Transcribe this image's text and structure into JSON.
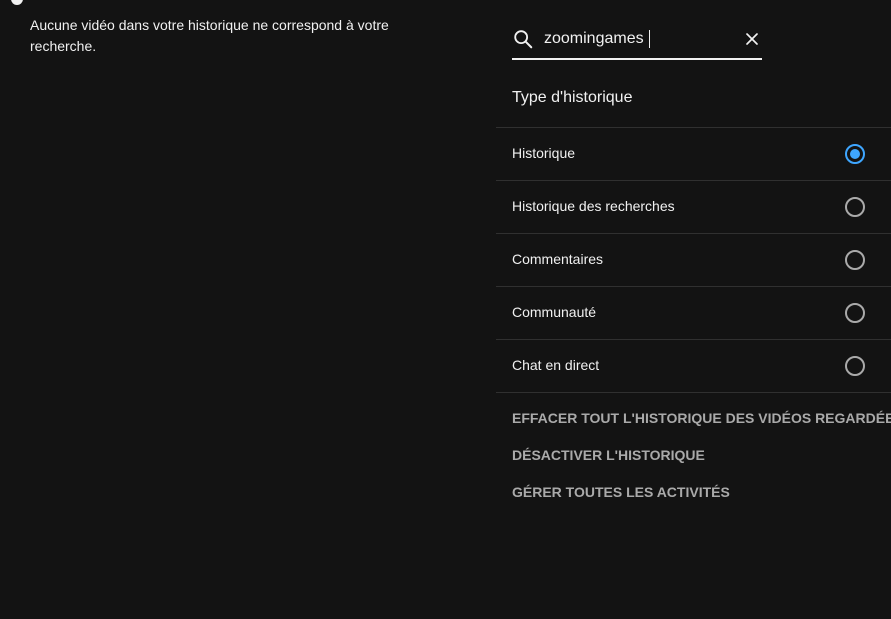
{
  "empty_message": "Aucune vidéo dans votre historique ne correspond à votre recherche.",
  "search": {
    "value": "zoomingames",
    "icon": "search-icon",
    "clear_icon": "close-icon"
  },
  "history_type": {
    "title": "Type d'historique",
    "options": [
      {
        "label": "Historique",
        "selected": true
      },
      {
        "label": "Historique des recherches",
        "selected": false
      },
      {
        "label": "Commentaires",
        "selected": false
      },
      {
        "label": "Communauté",
        "selected": false
      },
      {
        "label": "Chat en direct",
        "selected": false
      }
    ]
  },
  "actions": {
    "clear_all": "EFFACER TOUT L'HISTORIQUE DES VIDÉOS REGARDÉES",
    "pause": "DÉSACTIVER L'HISTORIQUE",
    "manage": "GÉRER TOUTES LES ACTIVITÉS"
  },
  "colors": {
    "background": "#131313",
    "text": "#f1f1f1",
    "muted": "#aaaaaa",
    "accent": "#3ea6ff",
    "divider": "#303030"
  }
}
